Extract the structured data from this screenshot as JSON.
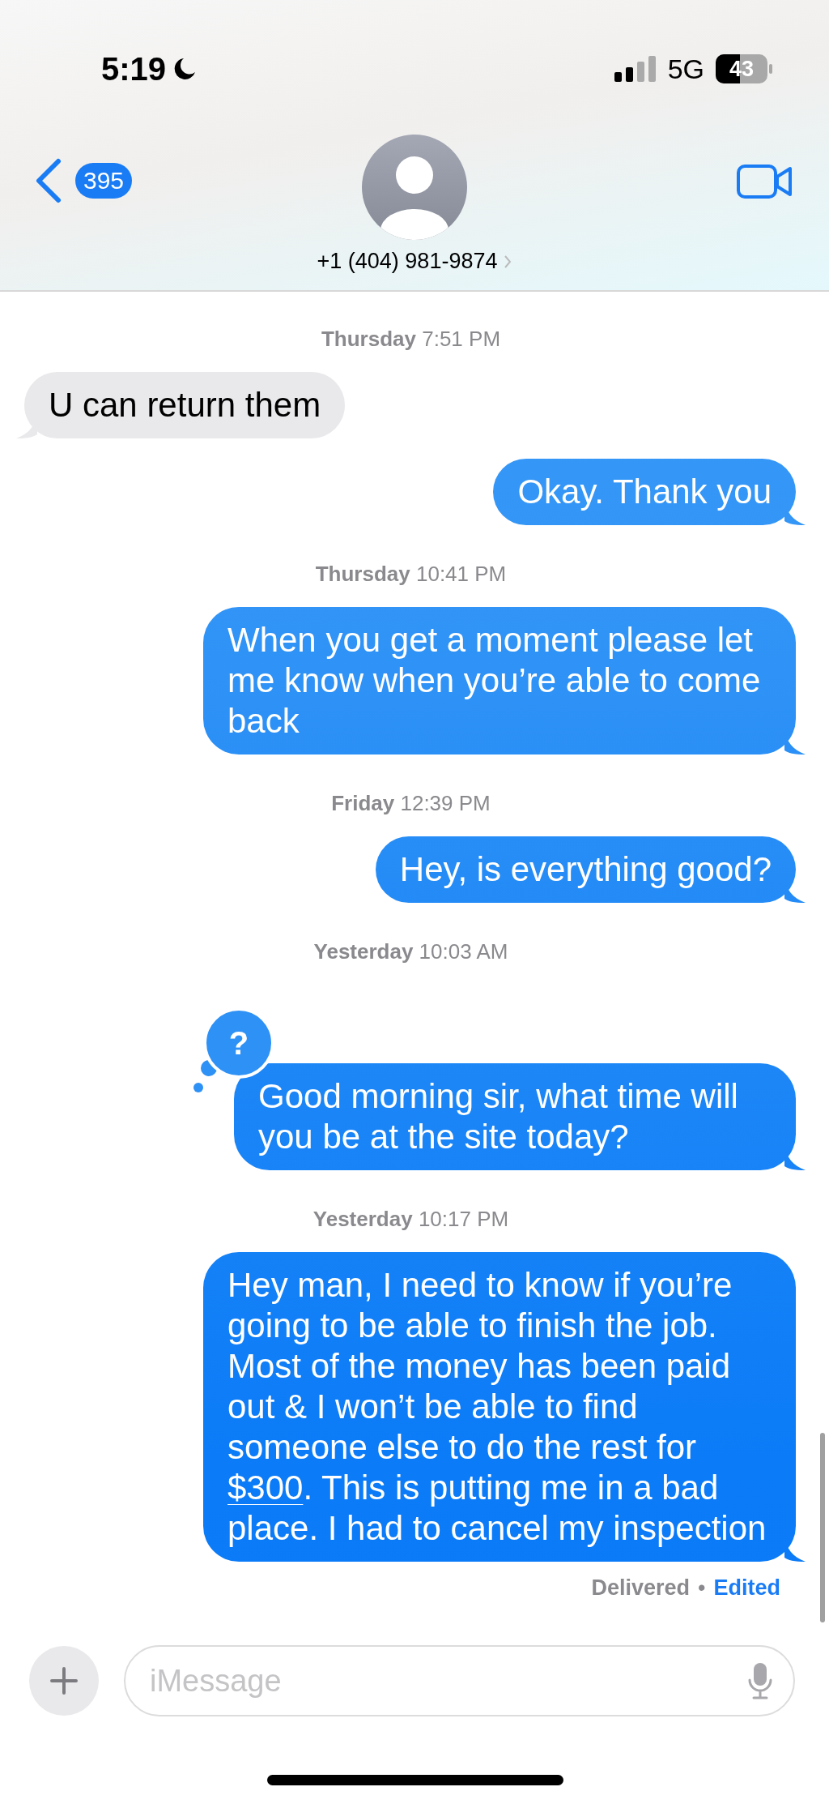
{
  "status_bar": {
    "time": "5:19",
    "network": "5G",
    "battery": "43"
  },
  "header": {
    "unread_count": "395",
    "contact": "+1 (404) 981-9874"
  },
  "conversation": [
    {
      "kind": "timestamp",
      "text": "**Thursday** 7:51 PM"
    },
    {
      "kind": "message",
      "outgoing": false,
      "parts": [
        {
          "text": "U can return them"
        }
      ]
    },
    {
      "kind": "message",
      "outgoing": true,
      "parts": [
        {
          "text": "Okay. Thank you"
        }
      ]
    },
    {
      "kind": "timestamp",
      "text": "**Thursday** 10:41 PM"
    },
    {
      "kind": "message",
      "outgoing": true,
      "parts": [
        {
          "text": "When you get a moment please let me know when you’re able to come back"
        }
      ]
    },
    {
      "kind": "timestamp",
      "text": "**Friday** 12:39 PM"
    },
    {
      "kind": "message",
      "outgoing": true,
      "parts": [
        {
          "text": "Hey, is everything good?"
        }
      ]
    },
    {
      "kind": "timestamp",
      "text": "**Yesterday** 10:03 AM"
    },
    {
      "kind": "message",
      "outgoing": true,
      "reaction": {
        "symbol": "?"
      },
      "parts": [
        {
          "text": "Good morning sir, what time will you be at the site today?"
        }
      ]
    },
    {
      "kind": "timestamp",
      "text": "**Yesterday** 10:17 PM"
    },
    {
      "kind": "message",
      "outgoing": true,
      "parts": [
        {
          "text": "Hey man, I need to know if you’re going to be able to finish the job. Most of the money has been paid out & I won’t be able to find someone else to do the rest for "
        },
        {
          "text": "$300",
          "kind": "link"
        },
        {
          "text": ". This is putting me in a bad place. I had to cancel my inspection"
        }
      ],
      "delivery": {
        "status": "Delivered",
        "separator": "•",
        "action": "Edited"
      }
    }
  ],
  "compose": {
    "placeholder": "iMessage"
  }
}
